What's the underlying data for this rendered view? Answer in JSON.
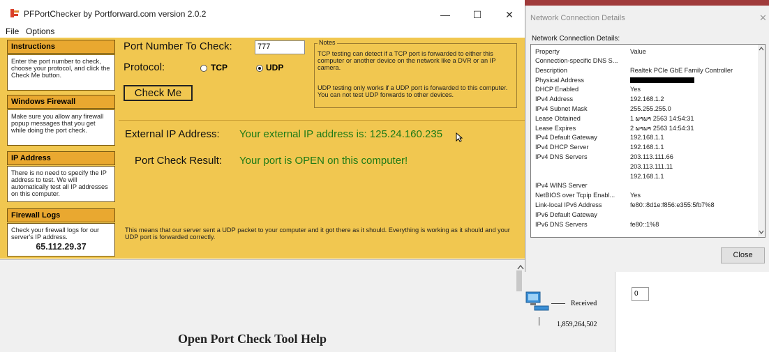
{
  "pf": {
    "title": "PFPortChecker by Portforward.com version 2.0.2",
    "menu": [
      "File",
      "Options"
    ],
    "window_buttons": {
      "minimize": "—",
      "maximize": "☐",
      "close": "✕"
    },
    "sidebar": {
      "instructions": {
        "heading": "Instructions",
        "text": "Enter the port number to check, choose your protocol, and click the Check Me button."
      },
      "firewall": {
        "heading": "Windows Firewall",
        "text": "Make sure you allow any firewall popup messages that you get while doing the port check."
      },
      "ip": {
        "heading": "IP Address",
        "text": "There is no need to specify the IP address to test. We will automatically test all IP addresses on this computer."
      },
      "logs": {
        "heading": "Firewall Logs",
        "text": "Check your firewall logs for our server's IP address.",
        "server_ip": "65.112.29.37"
      }
    },
    "port_label": "Port Number To Check:",
    "port_value": "777",
    "protocol_label": "Protocol:",
    "protocol_tcp": "TCP",
    "protocol_udp": "UDP",
    "check_button": "Check Me",
    "notes": {
      "legend": "Notes",
      "p1": "TCP testing can detect if a TCP port is forwarded to either this computer or another device on the network like a DVR or an IP camera.",
      "p2": "UDP testing only works if a UDP port is forwarded to this computer. You can not test UDP forwards to other devices."
    },
    "external_label": "External IP Address:",
    "external_value": "Your external IP address is: 125.24.160.235",
    "result_label": "Port Check Result:",
    "result_value": "Your port is OPEN on this computer!",
    "explanation": "This means that our server sent a UDP packet to your computer and it got there as it should. Everything is working as it should and your UDP port is forwarded correctly.",
    "help_title": "Open Port Check Tool Help"
  },
  "nc": {
    "title": "Network Connection Details",
    "subtitle": "Network Connection Details:",
    "columns": {
      "property": "Property",
      "value": "Value"
    },
    "rows": [
      {
        "p": "Connection-specific DNS S...",
        "v": ""
      },
      {
        "p": "Description",
        "v": "Realtek PCIe GbE Family Controller"
      },
      {
        "p": "Physical Address",
        "v": ""
      },
      {
        "p": "DHCP Enabled",
        "v": "Yes"
      },
      {
        "p": "IPv4 Address",
        "v": "192.168.1.2"
      },
      {
        "p": "IPv4 Subnet Mask",
        "v": "255.255.255.0"
      },
      {
        "p": "Lease Obtained",
        "v": "1 ພາພາ 2563 14:54:31"
      },
      {
        "p": "Lease Expires",
        "v": "2 ພາພາ 2563 14:54:31"
      },
      {
        "p": "IPv4 Default Gateway",
        "v": "192.168.1.1"
      },
      {
        "p": "IPv4 DHCP Server",
        "v": "192.168.1.1"
      },
      {
        "p": "IPv4 DNS Servers",
        "v": "203.113.111.66"
      },
      {
        "p": "",
        "v": "203.113.111.11"
      },
      {
        "p": "",
        "v": "192.168.1.1"
      },
      {
        "p": "IPv4 WINS Server",
        "v": ""
      },
      {
        "p": "NetBIOS over Tcpip Enabl...",
        "v": "Yes"
      },
      {
        "p": "Link-local IPv6 Address",
        "v": "fe80::8d1e:f856:e355:5fb7%8"
      },
      {
        "p": "IPv6 Default Gateway",
        "v": ""
      },
      {
        "p": "IPv6 DNS Servers",
        "v": "fe80::1%8"
      }
    ],
    "close_button": "Close",
    "window_close": "✕"
  },
  "background": {
    "received_label": "Received",
    "received_bytes": "1,859,264,502",
    "field_value": "0"
  }
}
